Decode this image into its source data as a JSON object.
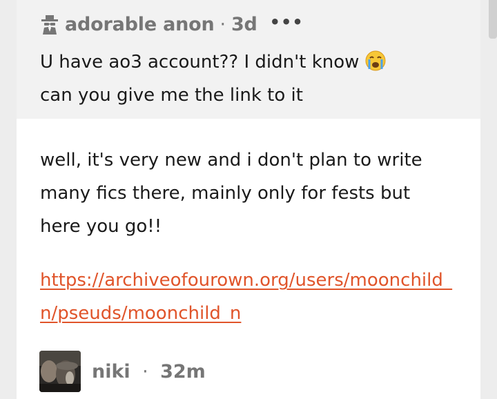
{
  "ask": {
    "author": "adorable anon",
    "separator": "·",
    "time": "3d",
    "more_label": "•••",
    "line1": "U have ao3 account?? I didn't know",
    "line2": "can you give me the link to it",
    "emoji": "crying-face"
  },
  "answer": {
    "text": "well, it's very new and i don't plan to write many fics there, mainly only for fests but here you go!!",
    "link": "https://archiveofourown.org/users/moonchild_n/pseuds/moonchild_n"
  },
  "reply": {
    "username": "niki",
    "separator": "·",
    "time": "32m"
  },
  "colors": {
    "link": "#e0542a",
    "meta": "#767676",
    "ask_bg": "#f2f2f2"
  }
}
